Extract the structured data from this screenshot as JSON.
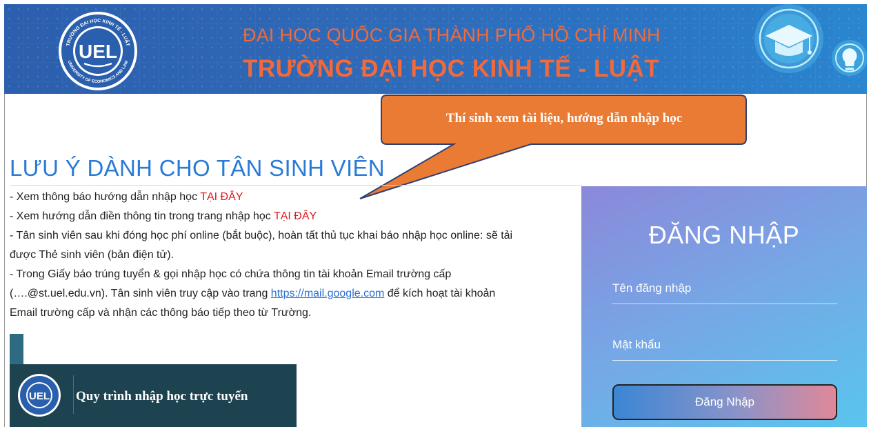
{
  "banner": {
    "university_line": "ĐẠI HỌC QUỐC GIA THÀNH PHỐ HỒ CHÍ MINH",
    "school_name": "TRƯỜNG ĐẠI HỌC KINH TẾ - LUẬT",
    "logo": {
      "text": "UEL",
      "ring_top": "TRƯỜNG ĐẠI HỌC KINH TẾ - LUẬT",
      "ring_bottom": "UNIVERSITY OF ECONOMICS AND LAW"
    }
  },
  "callout": {
    "text": "Thí sinh xem tài liệu, hướng dẫn nhập học"
  },
  "notice": {
    "heading": "LƯU Ý DÀNH CHO TÂN SINH VIÊN",
    "line1_prefix": "- Xem thông báo hướng dẫn nhập học ",
    "line1_link": "TẠI ĐÂY",
    "line2_prefix": "- Xem hướng dẫn điền thông tin trong trang nhập học ",
    "line2_link": "TẠI ĐÂY",
    "line3a": "- Tân sinh viên sau khi đóng học phí online (bắt buộc), hoàn tất thủ tục khai báo nhập học online: sẽ tải",
    "line3b": "được Thẻ sinh viên (bản điện tử).",
    "line4a": "- Trong Giấy báo trúng tuyển & gọi nhập học có chứa thông tin tài khoản Email trường cấp",
    "line4b_prefix": "(….@st.uel.edu.vn). Tân sinh viên truy cập vào trang ",
    "line4b_link": "https://mail.google.com",
    "line4b_suffix": " để kích hoạt tài khoản",
    "line4c": "Email trường cấp và nhận các thông báo tiếp theo từ Trường."
  },
  "promo": {
    "logo_text": "UEL",
    "title": "Quy trình nhập học trực tuyến"
  },
  "login": {
    "title": "ĐĂNG NHẬP",
    "username_placeholder": "Tên đăng nhập",
    "password_placeholder": "Mật khẩu",
    "submit_label": "Đăng Nhập"
  },
  "colors": {
    "banner_bg": "#2f6ab8",
    "banner_text": "#f26a3a",
    "heading_blue": "#2a7bd6",
    "link_red": "#e0191e",
    "callout_orange": "#ea7b34",
    "promo_bg": "#1e4350"
  }
}
